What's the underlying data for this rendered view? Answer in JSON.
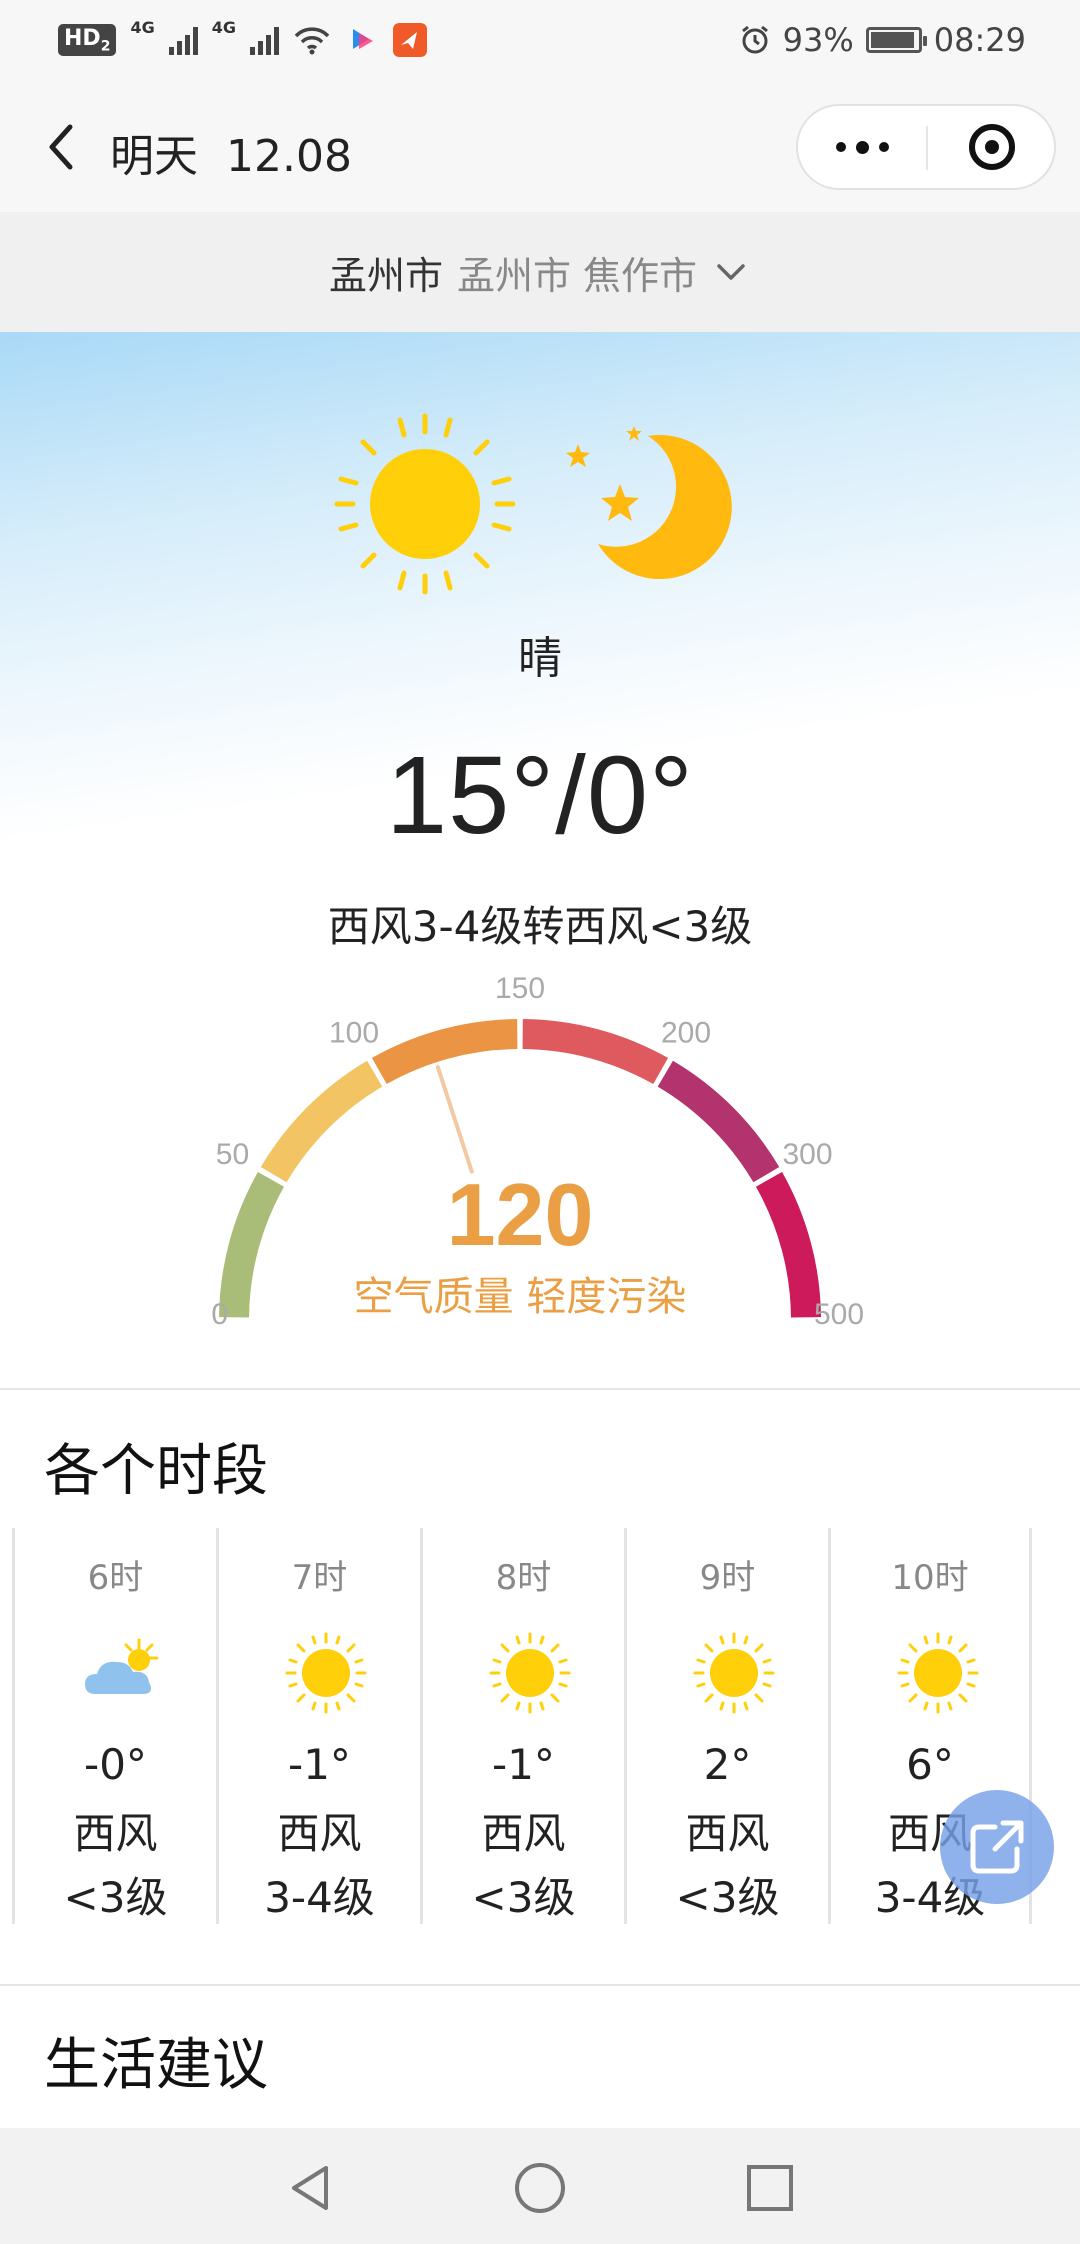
{
  "status_bar": {
    "hd_label": "HD",
    "hd_sub": "2",
    "net1": "4G",
    "net2": "4G",
    "battery_percent": "93%",
    "battery_level": 0.93,
    "time": "08:29"
  },
  "nav": {
    "title": "明天  12.08"
  },
  "location": {
    "primary": "孟州市",
    "secondary": "孟州市 焦作市"
  },
  "today": {
    "condition": "晴",
    "temp_range": "15°/0°",
    "wind": "西风3-4级转西风<3级"
  },
  "aqi": {
    "value": "120",
    "numeric": 120,
    "label": "空气质量 轻度污染",
    "ticks": [
      "0",
      "50",
      "100",
      "150",
      "200",
      "300",
      "500"
    ],
    "colors": {
      "good": "#a9bd78",
      "moderate": "#f2c464",
      "light": "#eb9444",
      "medium": "#de5a5e",
      "heavy": "#b3336e",
      "severe": "#cc1a5a",
      "value_text": "#ea9f45"
    }
  },
  "hourly": {
    "title": "各个时段",
    "items": [
      {
        "time": "6时",
        "icon": "partly-cloudy-icon",
        "temp": "-0°",
        "wind": "西风",
        "level": "<3级"
      },
      {
        "time": "7时",
        "icon": "sun-icon",
        "temp": "-1°",
        "wind": "西风",
        "level": "3-4级"
      },
      {
        "time": "8时",
        "icon": "sun-icon",
        "temp": "-1°",
        "wind": "西风",
        "level": "<3级"
      },
      {
        "time": "9时",
        "icon": "sun-icon",
        "temp": "2°",
        "wind": "西风",
        "level": "<3级"
      },
      {
        "time": "10时",
        "icon": "sun-icon",
        "temp": "6°",
        "wind": "西风",
        "level": "3-4级"
      }
    ]
  },
  "life": {
    "title": "生活建议"
  }
}
